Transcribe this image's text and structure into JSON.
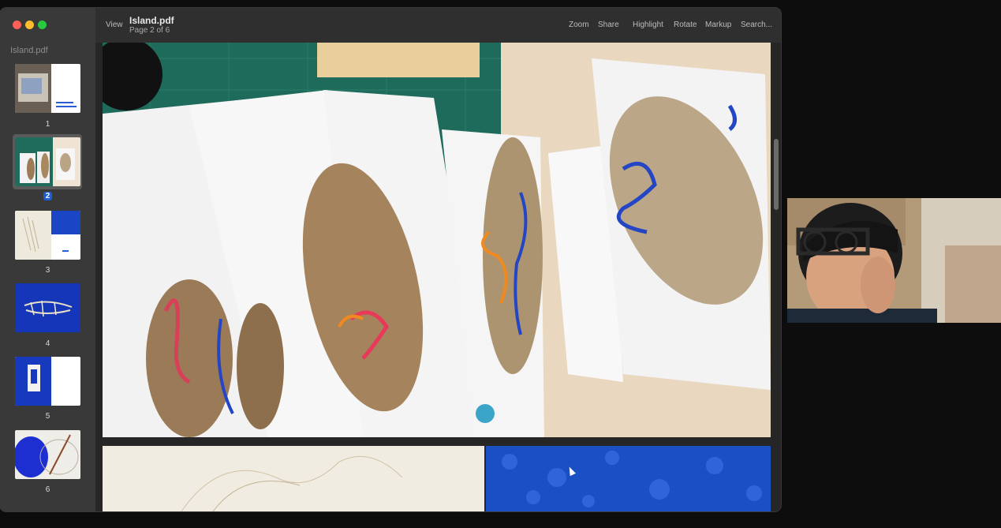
{
  "window": {
    "sidebar_title": "Island.pdf",
    "doc_title": "Island.pdf",
    "page_status": "Page 2 of 6",
    "current_page": 2,
    "total_pages": 6
  },
  "toolbar": {
    "view_label": "View",
    "zoom_label": "Zoom",
    "share_label": "Share",
    "highlight_label": "Highlight",
    "rotate_label": "Rotate",
    "markup_label": "Markup",
    "search_label": "Search..."
  },
  "thumbnails": [
    {
      "label": "1"
    },
    {
      "label": "2"
    },
    {
      "label": "3"
    },
    {
      "label": "4"
    },
    {
      "label": "5"
    },
    {
      "label": "6"
    }
  ],
  "colors": {
    "accent": "#1f5fd6",
    "close": "#fe5f57",
    "minimize": "#febc2e",
    "zoom": "#28c840"
  }
}
